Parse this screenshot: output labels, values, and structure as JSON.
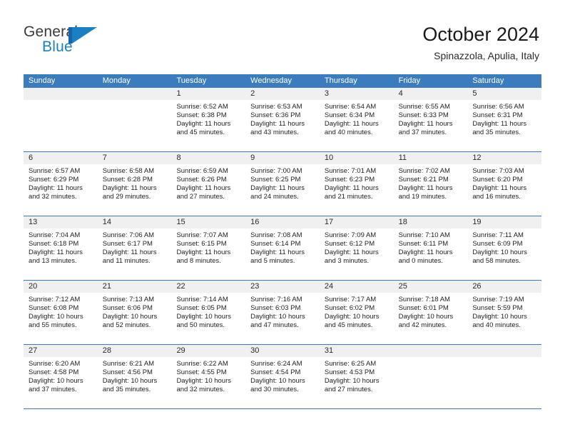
{
  "brand": {
    "name_top": "General",
    "name_bottom": "Blue",
    "mark": "triangle-logo",
    "color_primary": "#1b7fc4",
    "color_dark": "#3b3b3b"
  },
  "header": {
    "title": "October 2024",
    "subtitle": "Spinazzola, Apulia, Italy"
  },
  "theme": {
    "header_blue": "#3a7cbe",
    "day_band_gray": "#f0f0f0",
    "text": "#1f1f1f"
  },
  "weekdays": [
    "Sunday",
    "Monday",
    "Tuesday",
    "Wednesday",
    "Thursday",
    "Friday",
    "Saturday"
  ],
  "labels": {
    "sunrise_prefix": "Sunrise:",
    "sunset_prefix": "Sunset:",
    "daylight_prefix": "Daylight:"
  },
  "weeks": [
    [
      {
        "day": "",
        "sunrise": "",
        "sunset": "",
        "daylight_line1": "",
        "daylight_line2": ""
      },
      {
        "day": "",
        "sunrise": "",
        "sunset": "",
        "daylight_line1": "",
        "daylight_line2": ""
      },
      {
        "day": "1",
        "sunrise": "Sunrise: 6:52 AM",
        "sunset": "Sunset: 6:38 PM",
        "daylight_line1": "Daylight: 11 hours",
        "daylight_line2": "and 45 minutes."
      },
      {
        "day": "2",
        "sunrise": "Sunrise: 6:53 AM",
        "sunset": "Sunset: 6:36 PM",
        "daylight_line1": "Daylight: 11 hours",
        "daylight_line2": "and 43 minutes."
      },
      {
        "day": "3",
        "sunrise": "Sunrise: 6:54 AM",
        "sunset": "Sunset: 6:34 PM",
        "daylight_line1": "Daylight: 11 hours",
        "daylight_line2": "and 40 minutes."
      },
      {
        "day": "4",
        "sunrise": "Sunrise: 6:55 AM",
        "sunset": "Sunset: 6:33 PM",
        "daylight_line1": "Daylight: 11 hours",
        "daylight_line2": "and 37 minutes."
      },
      {
        "day": "5",
        "sunrise": "Sunrise: 6:56 AM",
        "sunset": "Sunset: 6:31 PM",
        "daylight_line1": "Daylight: 11 hours",
        "daylight_line2": "and 35 minutes."
      }
    ],
    [
      {
        "day": "6",
        "sunrise": "Sunrise: 6:57 AM",
        "sunset": "Sunset: 6:29 PM",
        "daylight_line1": "Daylight: 11 hours",
        "daylight_line2": "and 32 minutes."
      },
      {
        "day": "7",
        "sunrise": "Sunrise: 6:58 AM",
        "sunset": "Sunset: 6:28 PM",
        "daylight_line1": "Daylight: 11 hours",
        "daylight_line2": "and 29 minutes."
      },
      {
        "day": "8",
        "sunrise": "Sunrise: 6:59 AM",
        "sunset": "Sunset: 6:26 PM",
        "daylight_line1": "Daylight: 11 hours",
        "daylight_line2": "and 27 minutes."
      },
      {
        "day": "9",
        "sunrise": "Sunrise: 7:00 AM",
        "sunset": "Sunset: 6:25 PM",
        "daylight_line1": "Daylight: 11 hours",
        "daylight_line2": "and 24 minutes."
      },
      {
        "day": "10",
        "sunrise": "Sunrise: 7:01 AM",
        "sunset": "Sunset: 6:23 PM",
        "daylight_line1": "Daylight: 11 hours",
        "daylight_line2": "and 21 minutes."
      },
      {
        "day": "11",
        "sunrise": "Sunrise: 7:02 AM",
        "sunset": "Sunset: 6:21 PM",
        "daylight_line1": "Daylight: 11 hours",
        "daylight_line2": "and 19 minutes."
      },
      {
        "day": "12",
        "sunrise": "Sunrise: 7:03 AM",
        "sunset": "Sunset: 6:20 PM",
        "daylight_line1": "Daylight: 11 hours",
        "daylight_line2": "and 16 minutes."
      }
    ],
    [
      {
        "day": "13",
        "sunrise": "Sunrise: 7:04 AM",
        "sunset": "Sunset: 6:18 PM",
        "daylight_line1": "Daylight: 11 hours",
        "daylight_line2": "and 13 minutes."
      },
      {
        "day": "14",
        "sunrise": "Sunrise: 7:06 AM",
        "sunset": "Sunset: 6:17 PM",
        "daylight_line1": "Daylight: 11 hours",
        "daylight_line2": "and 11 minutes."
      },
      {
        "day": "15",
        "sunrise": "Sunrise: 7:07 AM",
        "sunset": "Sunset: 6:15 PM",
        "daylight_line1": "Daylight: 11 hours",
        "daylight_line2": "and 8 minutes."
      },
      {
        "day": "16",
        "sunrise": "Sunrise: 7:08 AM",
        "sunset": "Sunset: 6:14 PM",
        "daylight_line1": "Daylight: 11 hours",
        "daylight_line2": "and 5 minutes."
      },
      {
        "day": "17",
        "sunrise": "Sunrise: 7:09 AM",
        "sunset": "Sunset: 6:12 PM",
        "daylight_line1": "Daylight: 11 hours",
        "daylight_line2": "and 3 minutes."
      },
      {
        "day": "18",
        "sunrise": "Sunrise: 7:10 AM",
        "sunset": "Sunset: 6:11 PM",
        "daylight_line1": "Daylight: 11 hours",
        "daylight_line2": "and 0 minutes."
      },
      {
        "day": "19",
        "sunrise": "Sunrise: 7:11 AM",
        "sunset": "Sunset: 6:09 PM",
        "daylight_line1": "Daylight: 10 hours",
        "daylight_line2": "and 58 minutes."
      }
    ],
    [
      {
        "day": "20",
        "sunrise": "Sunrise: 7:12 AM",
        "sunset": "Sunset: 6:08 PM",
        "daylight_line1": "Daylight: 10 hours",
        "daylight_line2": "and 55 minutes."
      },
      {
        "day": "21",
        "sunrise": "Sunrise: 7:13 AM",
        "sunset": "Sunset: 6:06 PM",
        "daylight_line1": "Daylight: 10 hours",
        "daylight_line2": "and 52 minutes."
      },
      {
        "day": "22",
        "sunrise": "Sunrise: 7:14 AM",
        "sunset": "Sunset: 6:05 PM",
        "daylight_line1": "Daylight: 10 hours",
        "daylight_line2": "and 50 minutes."
      },
      {
        "day": "23",
        "sunrise": "Sunrise: 7:16 AM",
        "sunset": "Sunset: 6:03 PM",
        "daylight_line1": "Daylight: 10 hours",
        "daylight_line2": "and 47 minutes."
      },
      {
        "day": "24",
        "sunrise": "Sunrise: 7:17 AM",
        "sunset": "Sunset: 6:02 PM",
        "daylight_line1": "Daylight: 10 hours",
        "daylight_line2": "and 45 minutes."
      },
      {
        "day": "25",
        "sunrise": "Sunrise: 7:18 AM",
        "sunset": "Sunset: 6:01 PM",
        "daylight_line1": "Daylight: 10 hours",
        "daylight_line2": "and 42 minutes."
      },
      {
        "day": "26",
        "sunrise": "Sunrise: 7:19 AM",
        "sunset": "Sunset: 5:59 PM",
        "daylight_line1": "Daylight: 10 hours",
        "daylight_line2": "and 40 minutes."
      }
    ],
    [
      {
        "day": "27",
        "sunrise": "Sunrise: 6:20 AM",
        "sunset": "Sunset: 4:58 PM",
        "daylight_line1": "Daylight: 10 hours",
        "daylight_line2": "and 37 minutes."
      },
      {
        "day": "28",
        "sunrise": "Sunrise: 6:21 AM",
        "sunset": "Sunset: 4:56 PM",
        "daylight_line1": "Daylight: 10 hours",
        "daylight_line2": "and 35 minutes."
      },
      {
        "day": "29",
        "sunrise": "Sunrise: 6:22 AM",
        "sunset": "Sunset: 4:55 PM",
        "daylight_line1": "Daylight: 10 hours",
        "daylight_line2": "and 32 minutes."
      },
      {
        "day": "30",
        "sunrise": "Sunrise: 6:24 AM",
        "sunset": "Sunset: 4:54 PM",
        "daylight_line1": "Daylight: 10 hours",
        "daylight_line2": "and 30 minutes."
      },
      {
        "day": "31",
        "sunrise": "Sunrise: 6:25 AM",
        "sunset": "Sunset: 4:53 PM",
        "daylight_line1": "Daylight: 10 hours",
        "daylight_line2": "and 27 minutes."
      },
      {
        "day": "",
        "sunrise": "",
        "sunset": "",
        "daylight_line1": "",
        "daylight_line2": ""
      },
      {
        "day": "",
        "sunrise": "",
        "sunset": "",
        "daylight_line1": "",
        "daylight_line2": ""
      }
    ]
  ]
}
